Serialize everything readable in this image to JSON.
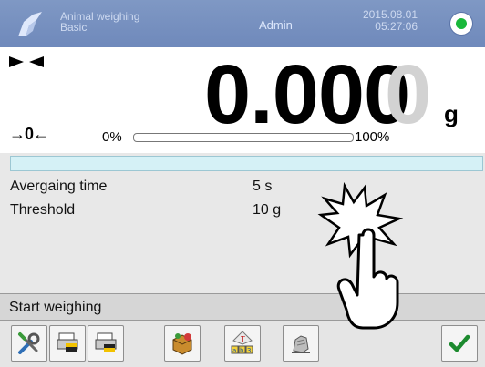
{
  "header": {
    "mode_line1": "Animal weighing",
    "mode_line2": "Basic",
    "user": "Admin",
    "date": "2015.08.01",
    "time": "05:27:06",
    "status_color": "#19b83b"
  },
  "display": {
    "weight": "0.000",
    "ghost_digit": "0",
    "unit": "g",
    "zero_symbol": "→0←",
    "bar_min": "0%",
    "bar_max": "100%",
    "bar_fill": 0,
    "stable": true
  },
  "info": [
    {
      "label": "Avergaing time",
      "value": "5 s"
    },
    {
      "label": "Threshold",
      "value": "10 g"
    }
  ],
  "function_label": "Start weighing",
  "softkeys": [
    {
      "icon": "tools-icon"
    },
    {
      "icon": "print-header-icon"
    },
    {
      "icon": "print-footer-icon"
    },
    {
      "icon": "product-database-icon"
    },
    {
      "icon": "label-print-icon"
    },
    {
      "icon": "animal-icon"
    },
    {
      "icon": "confirm-icon"
    }
  ],
  "colors": {
    "header": "#7f98c4",
    "panel": "#e8e8e8",
    "strip": "#d5f1f6",
    "confirm": "#1c8a2e"
  }
}
